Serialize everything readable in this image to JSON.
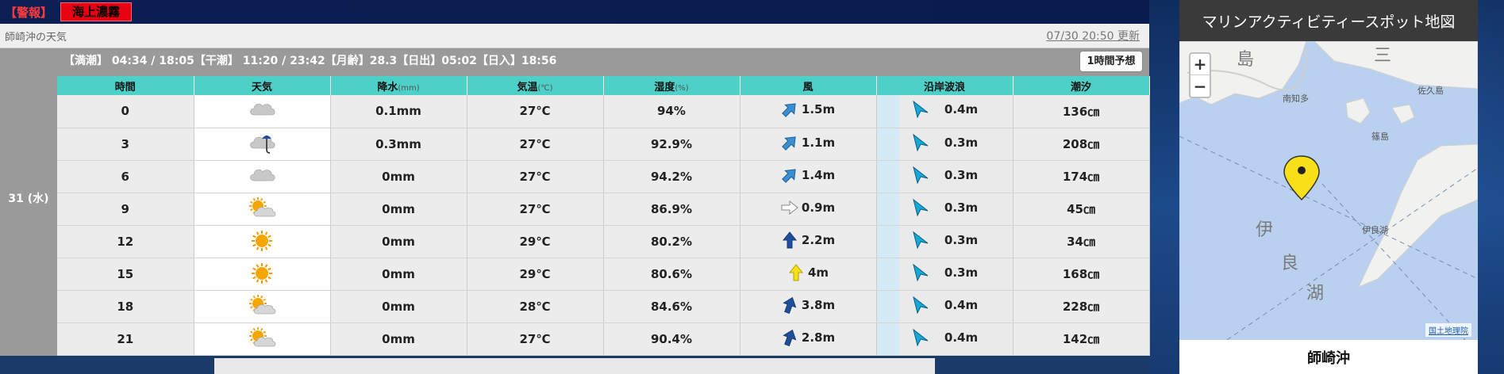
{
  "alert": {
    "label": "【警報】",
    "badge": "海上濃霧"
  },
  "location": {
    "title": "師崎沖の天気",
    "updated": "07/30 20:50 更新"
  },
  "tide_info": "【満潮】 04:34 / 18:05【干潮】 11:20 / 23:42【月齢】28.3【日出】05:02【日入】18:56",
  "hour_button": "1時間予想",
  "day_label": "31 (水)",
  "table": {
    "headers": {
      "time": "時間",
      "weather": "天気",
      "precip": "降水",
      "precip_unit": "(mm)",
      "temp": "気温",
      "temp_unit": "(℃)",
      "humidity": "湿度",
      "humidity_unit": "(%)",
      "wind": "風",
      "wave": "沿岸波浪",
      "tide": "潮汐"
    },
    "rows": [
      {
        "time": "0",
        "weather": "cloudy-icon",
        "precip": "0.1mm",
        "temp": "27℃",
        "humidity": "94%",
        "wind": "1.5m",
        "wind_dir": "northeast",
        "wave": "0.4m",
        "tide": "136㎝"
      },
      {
        "time": "3",
        "weather": "cloudy-rain-icon",
        "precip": "0.3mm",
        "temp": "27℃",
        "humidity": "92.9%",
        "wind": "1.1m",
        "wind_dir": "northeast",
        "wave": "0.3m",
        "tide": "208㎝"
      },
      {
        "time": "6",
        "weather": "cloudy-icon",
        "precip": "0mm",
        "temp": "27℃",
        "humidity": "94.2%",
        "wind": "1.4m",
        "wind_dir": "northeast",
        "wave": "0.3m",
        "tide": "174㎝"
      },
      {
        "time": "9",
        "weather": "sun-cloud-icon",
        "precip": "0mm",
        "temp": "27℃",
        "humidity": "86.9%",
        "wind": "0.9m",
        "wind_dir": "east",
        "wave": "0.3m",
        "tide": "45㎝"
      },
      {
        "time": "12",
        "weather": "sun-icon",
        "precip": "0mm",
        "temp": "29℃",
        "humidity": "80.2%",
        "wind": "2.2m",
        "wind_dir": "north",
        "wave": "0.3m",
        "tide": "34㎝"
      },
      {
        "time": "15",
        "weather": "sun-icon",
        "precip": "0mm",
        "temp": "29℃",
        "humidity": "80.6%",
        "wind": "4m",
        "wind_dir": "north-strong",
        "wave": "0.3m",
        "tide": "168㎝"
      },
      {
        "time": "18",
        "weather": "sun-cloud-icon",
        "precip": "0mm",
        "temp": "28℃",
        "humidity": "84.6%",
        "wind": "3.8m",
        "wind_dir": "north-northeast",
        "wave": "0.4m",
        "tide": "228㎝"
      },
      {
        "time": "21",
        "weather": "sun-cloud-icon",
        "precip": "0mm",
        "temp": "27℃",
        "humidity": "90.4%",
        "wind": "2.8m",
        "wind_dir": "north-northeast",
        "wave": "0.4m",
        "tide": "142㎝"
      }
    ]
  },
  "map": {
    "title": "マリンアクティビティースポット地図",
    "zoom_in": "+",
    "zoom_out": "−",
    "credit": "国土地理院",
    "spot_name": "師崎沖",
    "labels": {
      "island": "島",
      "san": "三",
      "i": "伊",
      "ryo": "良",
      "ko": "湖",
      "minami_chita": "南知多",
      "sakushima": "佐久島",
      "irago": "伊良湖",
      "kaminoshima": "篠島"
    }
  },
  "colors": {
    "header_teal": "#4dd0c8",
    "alert_red": "#e60012",
    "panel_gray": "#9a9a9a",
    "marker_yellow": "#f7e017"
  }
}
